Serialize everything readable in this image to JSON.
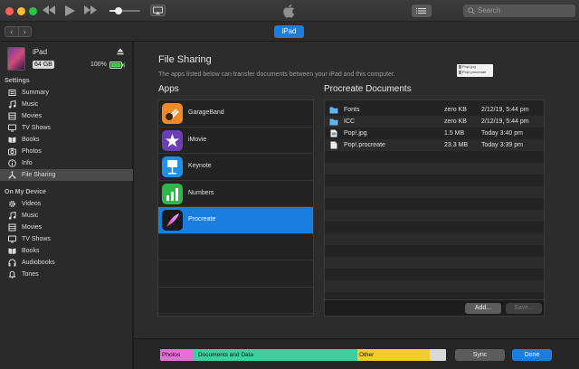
{
  "toolbar": {
    "volume_level": 0.3,
    "search_placeholder": "Search",
    "device_button": "iPad",
    "back_icon": "chevron-left-icon",
    "forward_icon": "chevron-right-icon"
  },
  "device": {
    "name": "iPad",
    "capacity": "64 GB",
    "battery": "100%"
  },
  "sidebar": {
    "settings_heading": "Settings",
    "settings_items": [
      {
        "label": "Summary",
        "icon": "summary-icon"
      },
      {
        "label": "Music",
        "icon": "music-note-icon"
      },
      {
        "label": "Movies",
        "icon": "film-icon"
      },
      {
        "label": "TV Shows",
        "icon": "tv-icon"
      },
      {
        "label": "Books",
        "icon": "book-icon"
      },
      {
        "label": "Photos",
        "icon": "camera-icon"
      },
      {
        "label": "Info",
        "icon": "info-icon"
      },
      {
        "label": "File Sharing",
        "icon": "file-sharing-icon",
        "selected": true
      }
    ],
    "on_device_heading": "On My Device",
    "device_items": [
      {
        "label": "Videos",
        "icon": "gear-icon"
      },
      {
        "label": "Music",
        "icon": "music-note-icon"
      },
      {
        "label": "Movies",
        "icon": "film-icon"
      },
      {
        "label": "TV Shows",
        "icon": "tv-icon"
      },
      {
        "label": "Books",
        "icon": "book-icon"
      },
      {
        "label": "Audiobooks",
        "icon": "headphones-icon"
      },
      {
        "label": "Tones",
        "icon": "bell-icon"
      }
    ]
  },
  "main": {
    "title": "File Sharing",
    "description": "The apps listed below can transfer documents between your iPad and this computer.",
    "preview_files": [
      "Pop!.jpg",
      "Pop!.procreate"
    ],
    "apps_heading": "Apps",
    "docs_heading": "Procreate Documents",
    "apps": [
      {
        "label": "GarageBand",
        "icon": "garageband-icon",
        "color": "#f08a24"
      },
      {
        "label": "iMovie",
        "icon": "imovie-icon",
        "color": "#6a3fb5"
      },
      {
        "label": "Keynote",
        "icon": "keynote-icon",
        "color": "#1e90e8"
      },
      {
        "label": "Numbers",
        "icon": "numbers-icon",
        "color": "#2db84a"
      },
      {
        "label": "Procreate",
        "icon": "procreate-icon",
        "color": "#1a1a1a",
        "selected": true
      }
    ],
    "documents": [
      {
        "name": "Fonts",
        "size": "zero KB",
        "date": "2/12/19, 5:44 pm",
        "icon": "folder-icon"
      },
      {
        "name": "ICC",
        "size": "zero KB",
        "date": "2/12/19, 5:44 pm",
        "icon": "folder-icon"
      },
      {
        "name": "Pop!.jpg",
        "size": "1.5 MB",
        "date": "Today 3:40 pm",
        "icon": "image-file-icon"
      },
      {
        "name": "Pop!.procreate",
        "size": "23.3 MB",
        "date": "Today 3:39 pm",
        "icon": "document-file-icon"
      }
    ],
    "add_label": "Add...",
    "save_label": "Save..."
  },
  "footer": {
    "storage": [
      {
        "label": "Photos",
        "color": "#e46fd5"
      },
      {
        "label": "",
        "color": "#3fcf9e"
      },
      {
        "label": "Documents and Data",
        "color": "#3fcf9e"
      },
      {
        "label": "Other",
        "color": "#f5cc29"
      },
      {
        "label": "",
        "color": "#d9d9d9"
      }
    ],
    "sync_label": "Sync",
    "done_label": "Done"
  },
  "colors": {
    "accent": "#1a7de0",
    "background": "#2c2c2c"
  }
}
